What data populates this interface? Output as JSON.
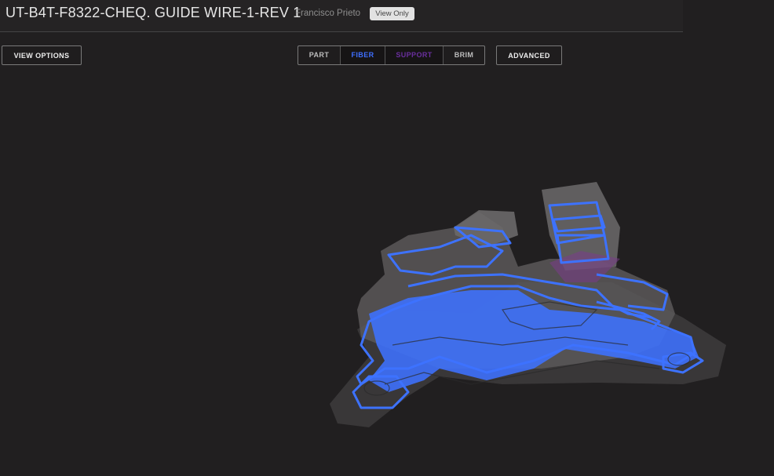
{
  "header": {
    "title": "UT-B4T-F8322-CHEQ. GUIDE WIRE-1-REV 1",
    "user": "Francisco Prieto",
    "badge": "View Only"
  },
  "toolbar": {
    "view_options_label": "VIEW OPTIONS",
    "advanced_label": "ADVANCED",
    "segments": [
      {
        "label": "PART",
        "color": "#bdbdbd"
      },
      {
        "label": "FIBER",
        "color": "#3f6fff"
      },
      {
        "label": "SUPPORT",
        "color": "#6a2f9e"
      },
      {
        "label": "BRIM",
        "color": "#bdbdbd"
      }
    ]
  },
  "colors": {
    "background": "#211f20",
    "fiber": "#3d72ff",
    "part": "#6a6868"
  }
}
